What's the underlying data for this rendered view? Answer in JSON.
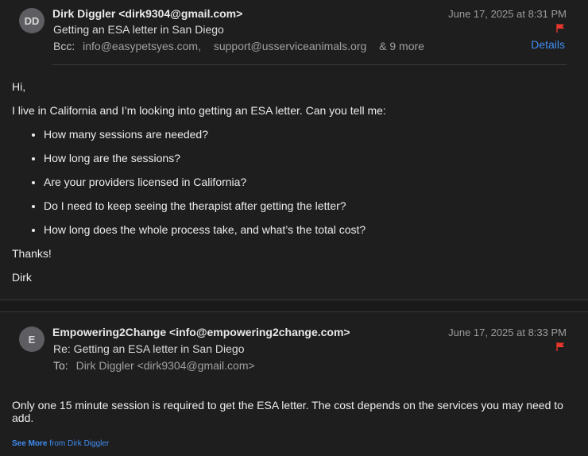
{
  "messages": [
    {
      "avatar": "DD",
      "from": "Dirk Diggler <dirk9304@gmail.com>",
      "date": "June 17, 2025 at 8:31 PM",
      "subject": "Getting an ESA letter in San Diego",
      "recipients_label": "Bcc:",
      "recipients": [
        "info@easypetsyes.com,",
        "support@usserviceanimals.org"
      ],
      "more": "& 9 more",
      "details_label": "Details",
      "flag_color": "#e8362d",
      "greeting": "Hi,",
      "intro": "I live in California and I’m looking into getting an ESA letter. Can you tell me:",
      "questions": [
        "How many sessions are needed?",
        "How long are the sessions?",
        "Are your providers licensed in California?",
        "Do I need to keep seeing the therapist after getting the letter?",
        "How long does the whole process take, and what’s the total cost?"
      ],
      "thanks": "Thanks!",
      "signature": "Dirk"
    },
    {
      "avatar": "E",
      "from": "Empowering2Change <info@empowering2change.com>",
      "date": "June 17, 2025 at 8:33 PM",
      "subject": "Re: Getting an ESA letter in San Diego",
      "recipients_label": "To:",
      "recipients": [
        "Dirk Diggler <dirk9304@gmail.com>"
      ],
      "flag_color": "#e8362d",
      "body": "Only one 15 minute session is required to get the ESA letter. The cost depends on the services you may need to add.",
      "see_more": "See More",
      "see_more_from": "from Dirk Diggler"
    }
  ],
  "colors": {
    "background": "#1e1e1e",
    "link": "#3f8cf0",
    "flag": "#e8362d",
    "avatar": "#5d5d62"
  }
}
